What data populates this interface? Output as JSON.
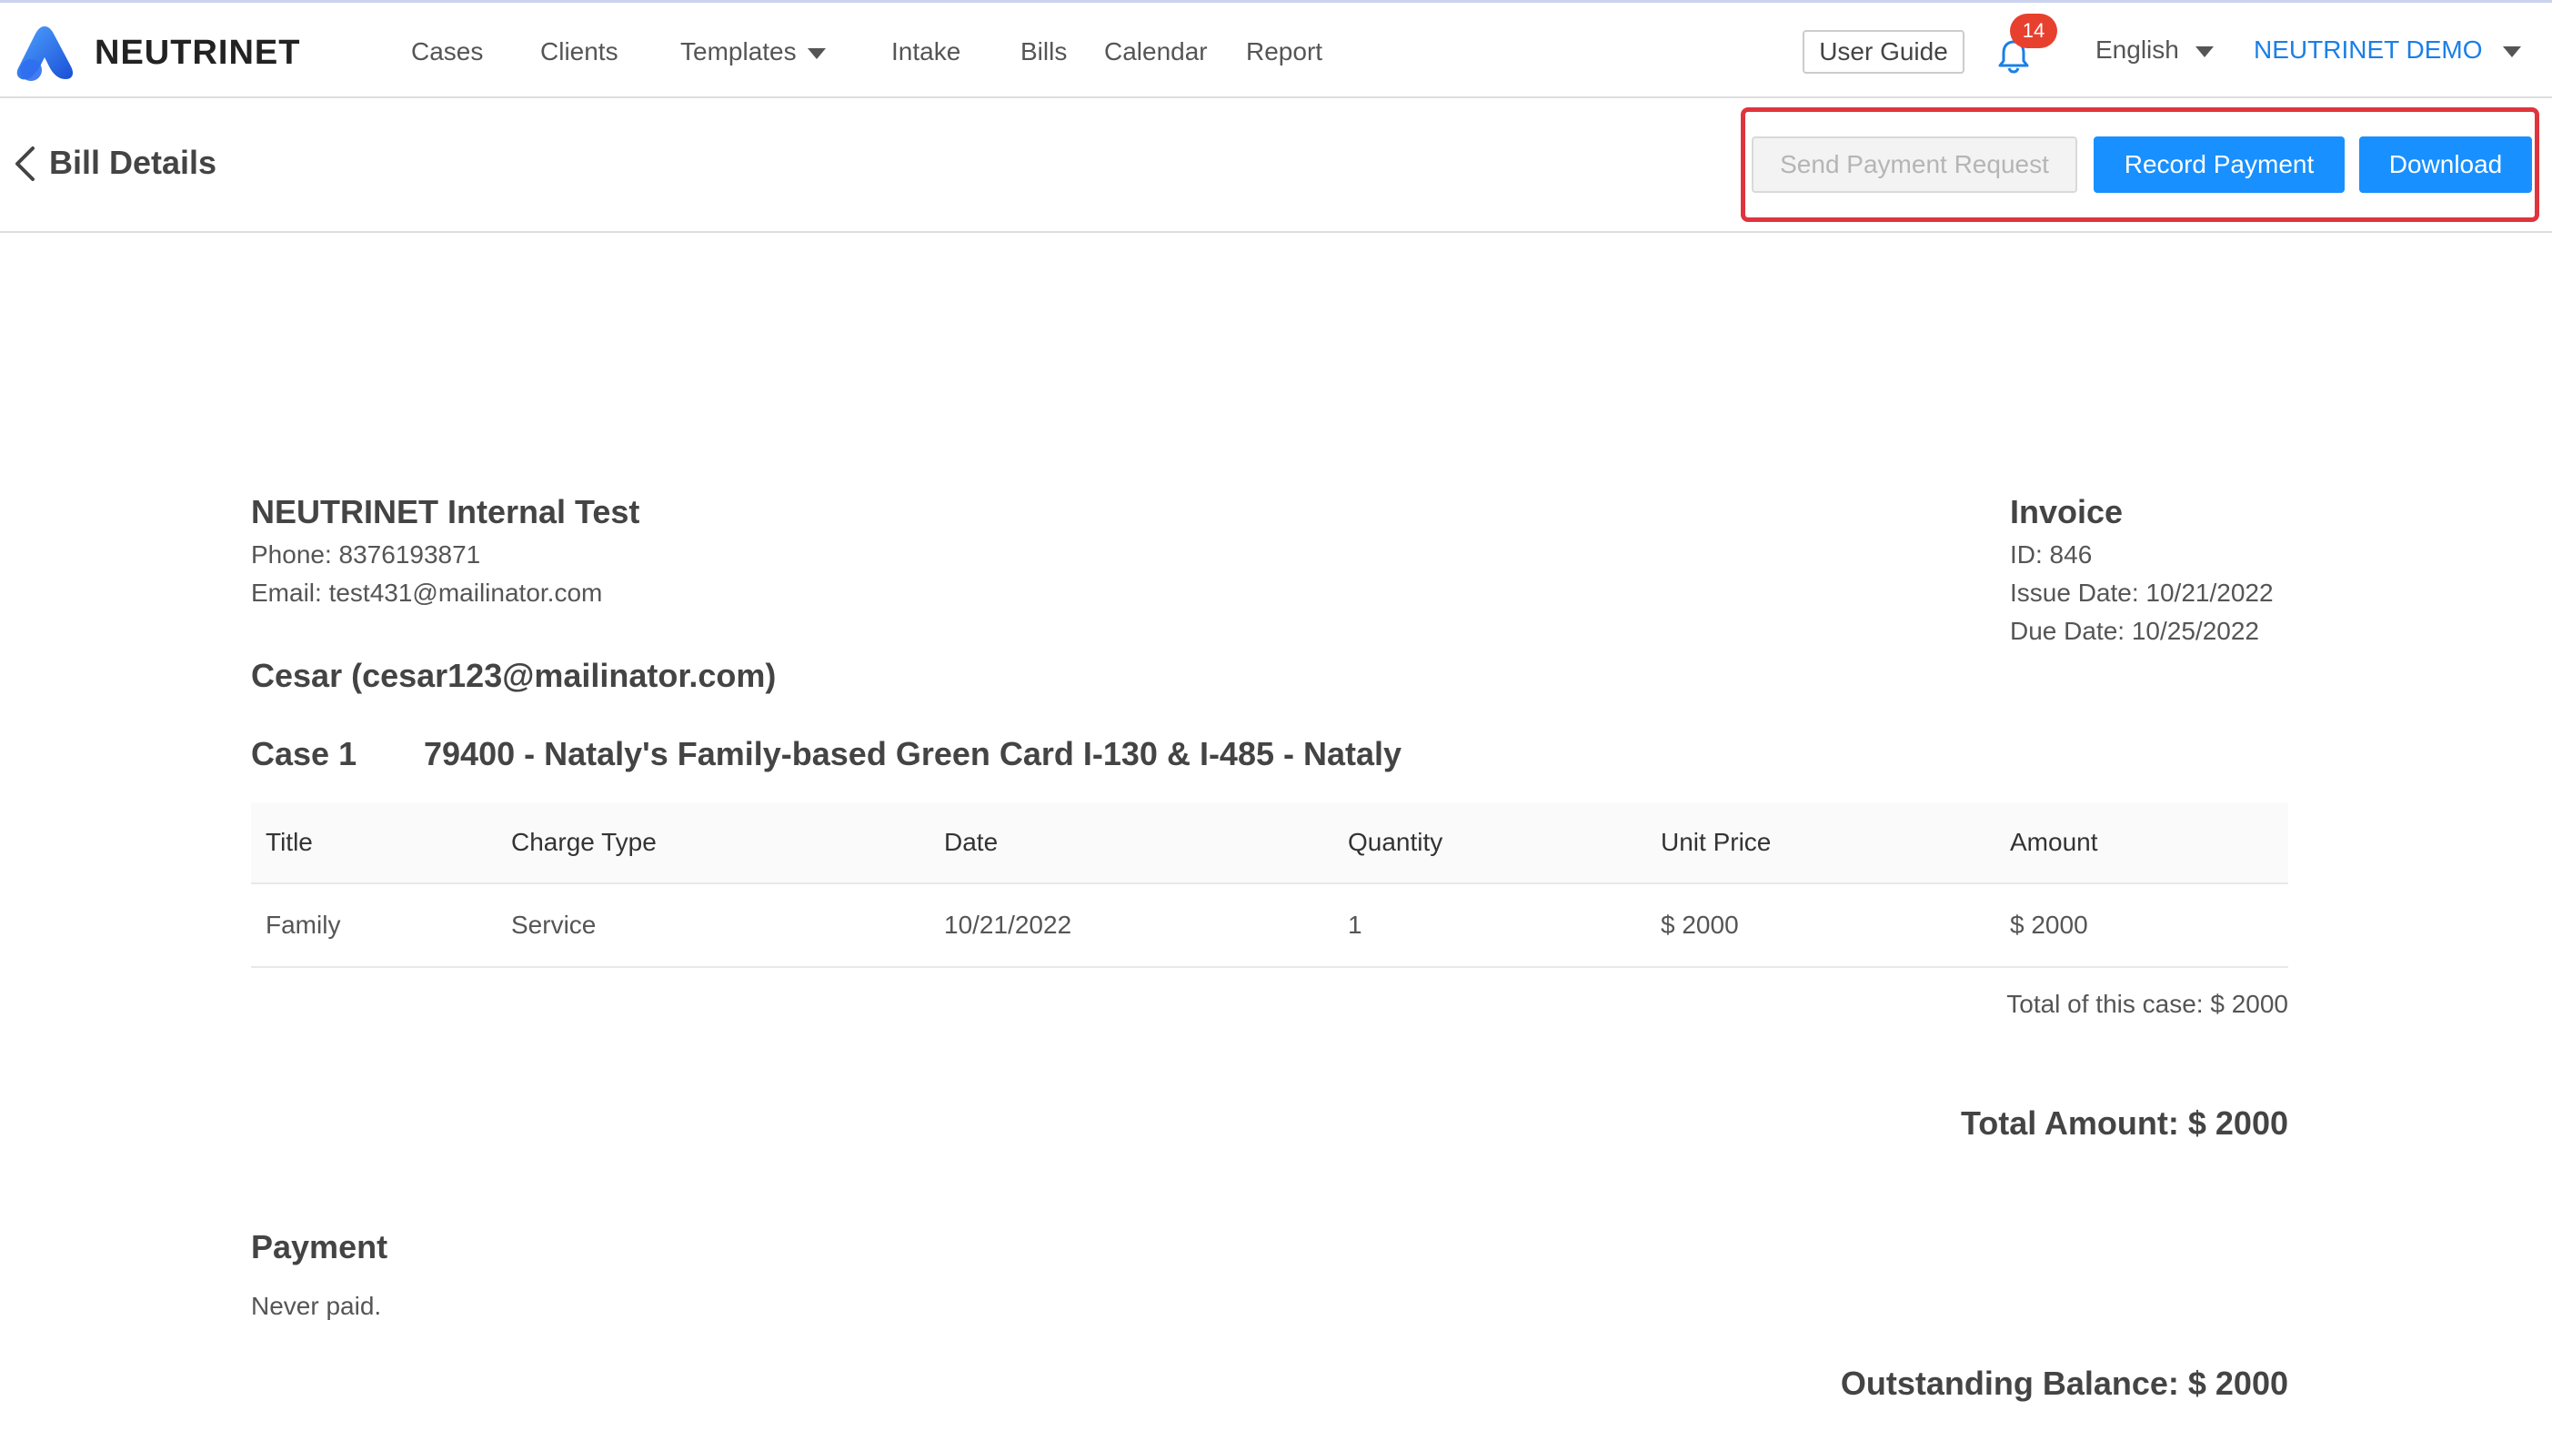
{
  "brand": {
    "name": "NEUTRINET",
    "accent": "#1890ff"
  },
  "nav": {
    "items": [
      {
        "label": "Cases"
      },
      {
        "label": "Clients"
      },
      {
        "label": "Templates"
      },
      {
        "label": "Intake"
      },
      {
        "label": "Bills"
      },
      {
        "label": "Calendar"
      },
      {
        "label": "Report"
      }
    ],
    "user_guide": "User Guide",
    "notification_count": "14",
    "language": "English",
    "account": "NEUTRINET DEMO"
  },
  "header": {
    "title": "Bill Details",
    "buttons": {
      "send_payment_request": "Send Payment Request",
      "record_payment": "Record Payment",
      "download": "Download"
    }
  },
  "firm": {
    "name": "NEUTRINET Internal Test",
    "phone": "Phone: 8376193871",
    "email": "Email: test431@mailinator.com"
  },
  "invoice": {
    "title": "Invoice",
    "id": "ID: 846",
    "issue_date": "Issue Date: 10/21/2022",
    "due_date": "Due Date: 10/25/2022"
  },
  "client": "Cesar (cesar123@mailinator.com)",
  "case": {
    "label": "Case 1",
    "name": "79400 - Nataly's Family-based Green Card I-130 & I-485 - Nataly",
    "columns": [
      "Title",
      "Charge Type",
      "Date",
      "Quantity",
      "Unit Price",
      "Amount"
    ],
    "rows": [
      [
        "Family",
        "Service",
        "10/21/2022",
        "1",
        "$ 2000",
        "$ 2000"
      ]
    ],
    "total": "Total of this case: $ 2000"
  },
  "total_amount": "Total Amount: $ 2000",
  "payment": {
    "title": "Payment",
    "status": "Never paid."
  },
  "outstanding_balance": "Outstanding Balance: $ 2000"
}
